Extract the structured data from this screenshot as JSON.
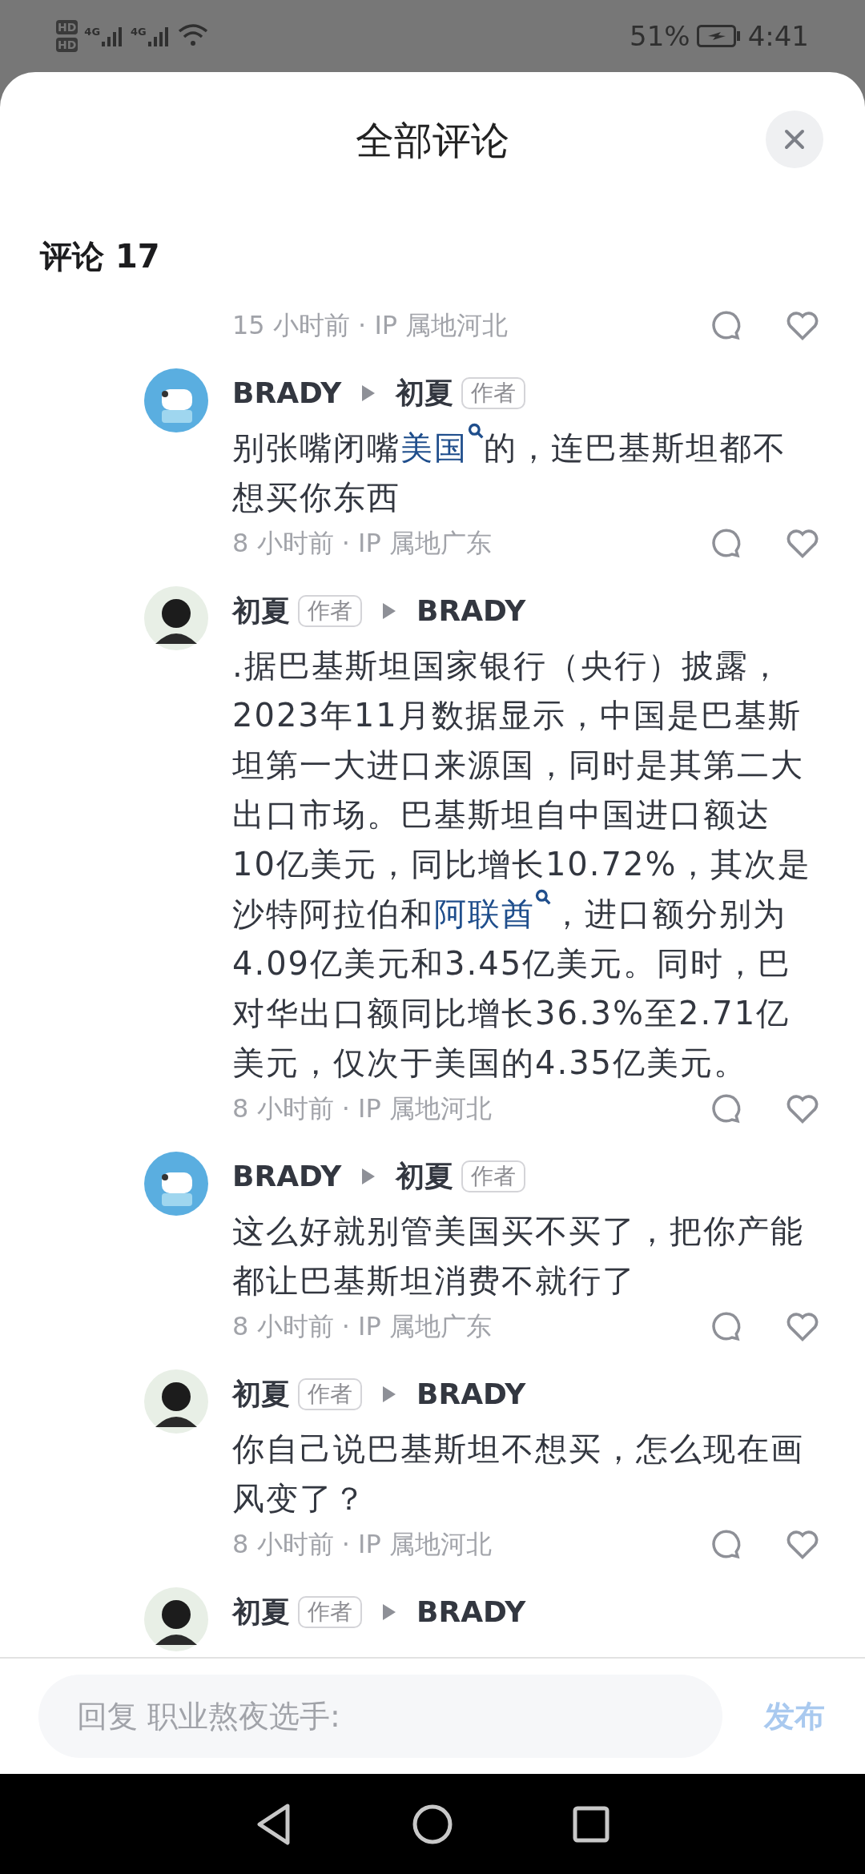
{
  "status_bar": {
    "sims": [
      {
        "badge": "HD",
        "network": "4G"
      },
      {
        "badge": "HD",
        "network": "4G"
      }
    ],
    "battery": "51%",
    "time": "4:41"
  },
  "sheet": {
    "title": "全部评论",
    "comment_count_label": "评论 17"
  },
  "comments": [
    {
      "kind": "meta_only",
      "meta": "15 小时前 · IP 属地河北"
    },
    {
      "kind": "full",
      "avatar": {
        "kind": "cartoon"
      },
      "author": {
        "name": "BRADY"
      },
      "reply_to": {
        "name": "初夏",
        "tag": "作者"
      },
      "text": [
        {
          "text": "别张嘴闭嘴"
        },
        {
          "text": "美国",
          "link": true
        },
        {
          "text": "的，连巴基斯坦都不想买你东西"
        }
      ],
      "meta": "8 小时前 · IP 属地广东"
    },
    {
      "kind": "full",
      "avatar": {
        "kind": "photo"
      },
      "author": {
        "name": "初夏",
        "tag": "作者"
      },
      "reply_to": {
        "name": "BRADY"
      },
      "text": [
        {
          "text": ".据巴基斯坦国家银行（央行）披露，2023年11月数据显示，中国是巴基斯坦第一大进口来源国，同时是其第二大出口市场。巴基斯坦自中国进口额达10亿美元，同比增长10.72%，其次是沙特阿拉伯和"
        },
        {
          "text": "阿联酋",
          "link": true
        },
        {
          "text": "，进口额分别为4.09亿美元和3.45亿美元。同时，巴对华出口额同比增长36.3%至2.71亿美元，仅次于美国的4.35亿美元。"
        }
      ],
      "meta": "8 小时前 · IP 属地河北"
    },
    {
      "kind": "full",
      "avatar": {
        "kind": "cartoon"
      },
      "author": {
        "name": "BRADY"
      },
      "reply_to": {
        "name": "初夏",
        "tag": "作者"
      },
      "text": [
        {
          "text": "这么好就别管美国买不买了，把你产能都让巴基斯坦消费不就行了"
        }
      ],
      "meta": "8 小时前 · IP 属地广东"
    },
    {
      "kind": "full",
      "avatar": {
        "kind": "photo"
      },
      "author": {
        "name": "初夏",
        "tag": "作者"
      },
      "reply_to": {
        "name": "BRADY"
      },
      "text": [
        {
          "text": "你自己说巴基斯坦不想买，怎么现在画风变了？"
        }
      ],
      "meta": "8 小时前 · IP 属地河北"
    },
    {
      "kind": "header_only",
      "avatar": {
        "kind": "photo"
      },
      "author": {
        "name": "初夏",
        "tag": "作者"
      },
      "reply_to": {
        "name": "BRADY"
      }
    }
  ],
  "reply_bar": {
    "placeholder": "回复 职业熬夜选手:",
    "send": "发布",
    "send_disabled": true
  }
}
